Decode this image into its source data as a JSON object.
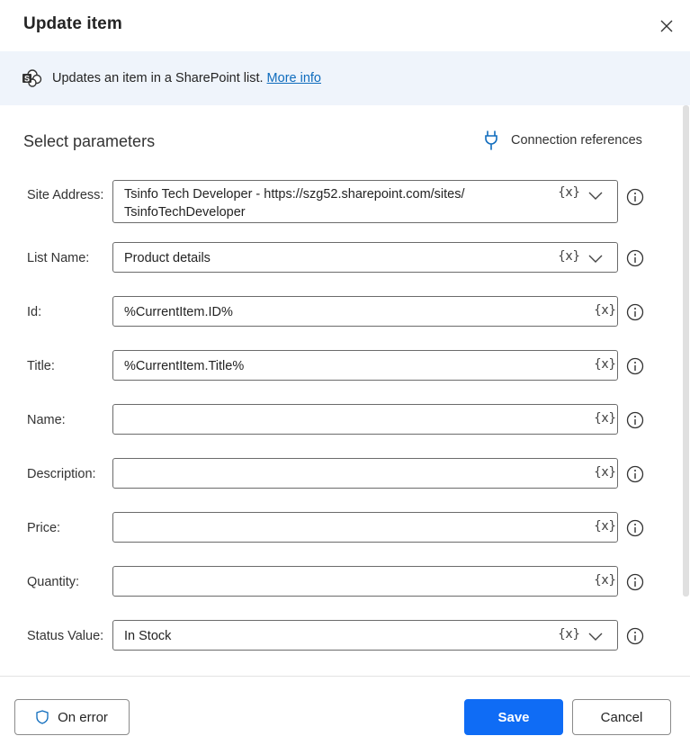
{
  "dialog": {
    "title": "Update item",
    "close_icon": "close-icon"
  },
  "info": {
    "icon": "sharepoint-icon",
    "text": "Updates an item in a SharePoint list.",
    "link_label": "More info"
  },
  "section": {
    "title": "Select parameters",
    "connection_references_label": "Connection references",
    "connection_icon": "plug-icon"
  },
  "fields": [
    {
      "label": "Site Address:",
      "value_line1": "Tsinfo Tech Developer - https://szg52.sharepoint.com/sites/",
      "value_line2": "TsinfoTechDeveloper",
      "type": "dropdown",
      "variable_label": "{x}"
    },
    {
      "label": "List Name:",
      "value": "Product details",
      "type": "dropdown",
      "variable_label": "{x}"
    },
    {
      "label": "Id:",
      "value": "%CurrentItem.ID%",
      "type": "text",
      "variable_label": "{x}"
    },
    {
      "label": "Title:",
      "value": "%CurrentItem.Title%",
      "type": "text",
      "variable_label": "{x}"
    },
    {
      "label": "Name:",
      "value": "",
      "type": "text",
      "variable_label": "{x}"
    },
    {
      "label": "Description:",
      "value": "",
      "type": "text",
      "variable_label": "{x}"
    },
    {
      "label": "Price:",
      "value": "",
      "type": "text",
      "variable_label": "{x}"
    },
    {
      "label": "Quantity:",
      "value": "",
      "type": "text",
      "variable_label": "{x}"
    },
    {
      "label": "Status Value:",
      "value": "In Stock",
      "type": "dropdown",
      "variable_label": "{x}"
    }
  ],
  "footer": {
    "on_error_label": "On error",
    "on_error_icon": "shield-icon",
    "save_label": "Save",
    "cancel_label": "Cancel"
  },
  "colors": {
    "primary": "#0f6cf5",
    "link": "#0f6cbd",
    "info_strip_bg": "#eff4fb"
  }
}
